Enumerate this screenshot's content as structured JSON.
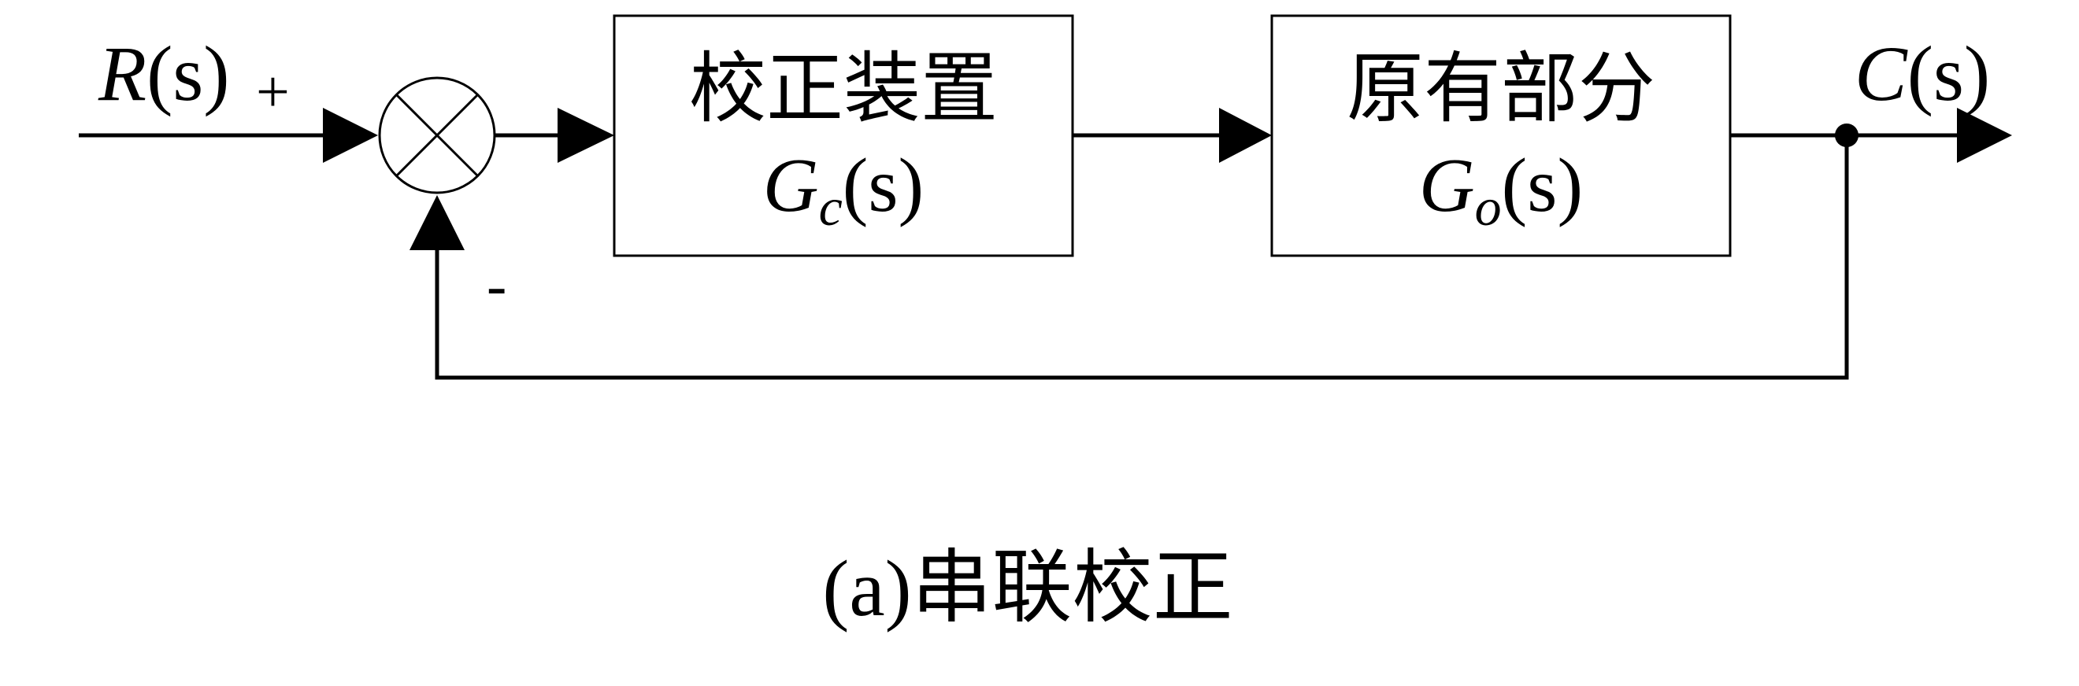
{
  "diagram": {
    "input": {
      "symbol": "R",
      "arg": "(s)"
    },
    "output": {
      "symbol": "C",
      "arg": "(s)"
    },
    "summing_junction": {
      "plus_sign": "+",
      "minus_sign": "-"
    },
    "blocks": [
      {
        "title": "校正装置",
        "symbol": "G",
        "subscript": "c",
        "arg": "(s)"
      },
      {
        "title": "原有部分",
        "symbol": "G",
        "subscript": "o",
        "arg": "(s)"
      }
    ],
    "caption": "(a)串联校正"
  }
}
